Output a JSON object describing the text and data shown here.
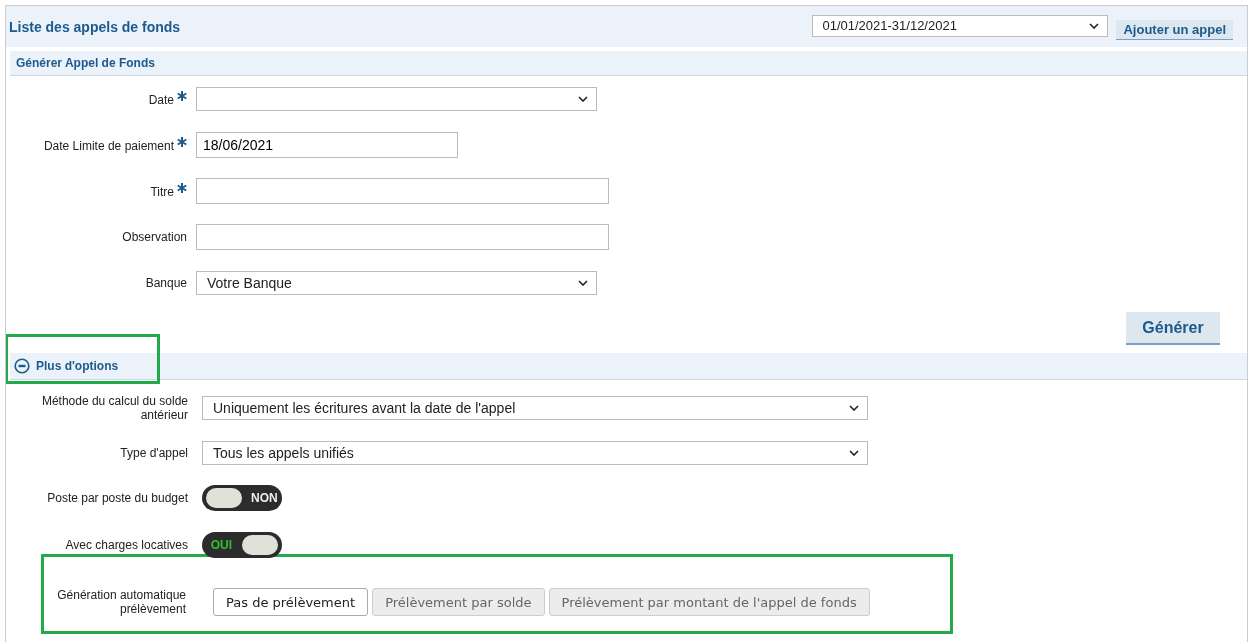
{
  "header": {
    "title": "Liste des appels de fonds",
    "period": {
      "value": "01/01/2021-31/12/2021"
    },
    "add_button": "Ajouter un appel"
  },
  "form": {
    "title": "Générer Appel de Fonds",
    "fields": [
      {
        "kind": "select",
        "label": "Date",
        "required": true
      },
      {
        "kind": "date",
        "label": "Date Limite de paiement",
        "required": true,
        "value": "18/06/2021"
      },
      {
        "kind": "text",
        "label": "Titre",
        "required": true
      },
      {
        "kind": "text",
        "label": "Observation",
        "required": false
      },
      {
        "kind": "select",
        "label": "Banque",
        "required": false,
        "value": "Votre Banque"
      }
    ],
    "generate_button": "Générer"
  },
  "options": {
    "title": "Plus d'options",
    "expanded": true,
    "highlighted": true,
    "selects": [
      {
        "label": "Méthode du calcul du solde antérieur",
        "value": "Uniquement les écritures avant la date de l'appel"
      },
      {
        "label": "Type d'appel",
        "value": "Tous les appels unifiés"
      }
    ],
    "toggles": [
      {
        "label": "Poste par poste du budget",
        "on": false,
        "text": "NON"
      },
      {
        "label": "Avec charges locatives",
        "on": true,
        "text": "OUI"
      }
    ],
    "auto_debit": {
      "label": "Génération automatique prélèvement",
      "highlighted": true,
      "choices": [
        {
          "label": "Pas de prélèvement",
          "selected": true
        },
        {
          "label": "Prélèvement par solde",
          "selected": false
        },
        {
          "label": "Prélèvement par montant de l'appel de fonds",
          "selected": false
        }
      ]
    }
  }
}
